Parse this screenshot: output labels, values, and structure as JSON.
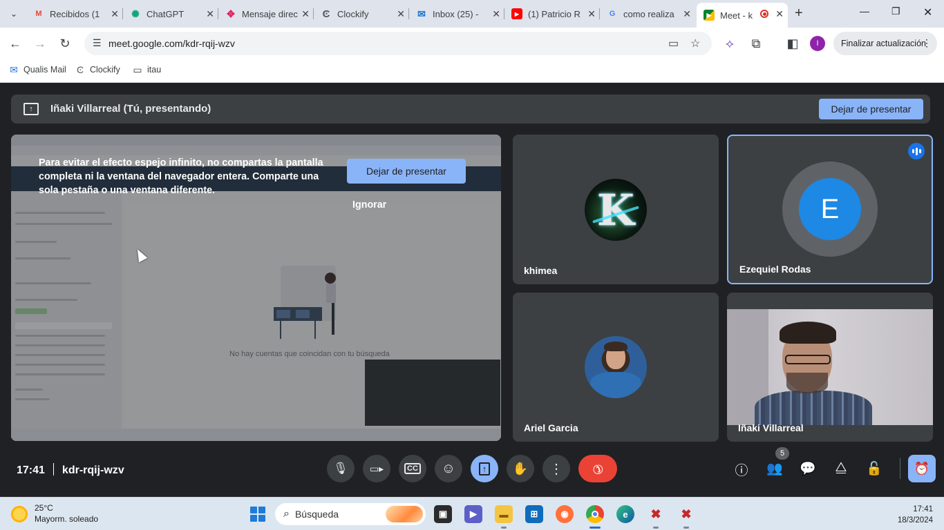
{
  "browser": {
    "tabs": [
      {
        "title": "Recibidos (1",
        "icon": "gmail-icon",
        "icon_color": "#ea4335"
      },
      {
        "title": "ChatGPT",
        "icon": "chatgpt-icon",
        "icon_color": "#10a37f"
      },
      {
        "title": "Mensaje direc",
        "icon": "slack-icon",
        "icon_color": "#611f69"
      },
      {
        "title": "Clockify",
        "icon": "clockify-icon",
        "icon_color": "#03a9f4"
      },
      {
        "title": "Inbox (25) - ",
        "icon": "mail-icon",
        "icon_color": "#1976d2"
      },
      {
        "title": "(1) Patricio R",
        "icon": "youtube-icon",
        "icon_color": "#ff0000"
      },
      {
        "title": "como realiza",
        "icon": "google-icon",
        "icon_color": "#4285f4"
      },
      {
        "title": "Meet - k",
        "icon": "meet-icon",
        "icon_color": "#00897b"
      }
    ],
    "url": "meet.google.com/kdr-rqij-wzv",
    "profile_initial": "I",
    "update_button": "Finalizar actualización",
    "bookmarks": [
      {
        "label": "Qualis Mail",
        "icon": "mail-icon"
      },
      {
        "label": "Clockify",
        "icon": "clockify-icon"
      },
      {
        "label": "itau",
        "icon": "folder-icon"
      }
    ]
  },
  "meet": {
    "presenting_title": "Iñaki Villarreal (Tú, presentando)",
    "stop_presenting": "Dejar de presentar",
    "warning_text": "Para evitar el efecto espejo infinito, no compartas la pantalla completa ni la ventana del navegador entera. Comparte una sola pestaña o una ventana diferente.",
    "warning_stop": "Dejar de presentar",
    "warning_ignore": "Ignorar",
    "shared_screen_empty_text": "No hay cuentas que coincidan con tu búsqueda",
    "participants": [
      {
        "name": "khimea",
        "avatar": "k-logo-avatar"
      },
      {
        "name": "Ezequiel Rodas",
        "avatar_letter": "E",
        "avatar_color": "#1e88e5",
        "speaking": true
      },
      {
        "name": "Ariel Garcia",
        "avatar": "photo-avatar"
      },
      {
        "name": "Iñaki Villarreal",
        "avatar": "camera-feed"
      }
    ],
    "time": "17:41",
    "meeting_code": "kdr-rqij-wzv",
    "participants_count": "5",
    "accent_color": "#8ab4f8",
    "end_call_color": "#ea4335"
  },
  "taskbar": {
    "temperature": "25°C",
    "weather": "Mayorm. soleado",
    "search_placeholder": "Búsqueda",
    "time": "17:41",
    "date": "18/3/2024"
  }
}
